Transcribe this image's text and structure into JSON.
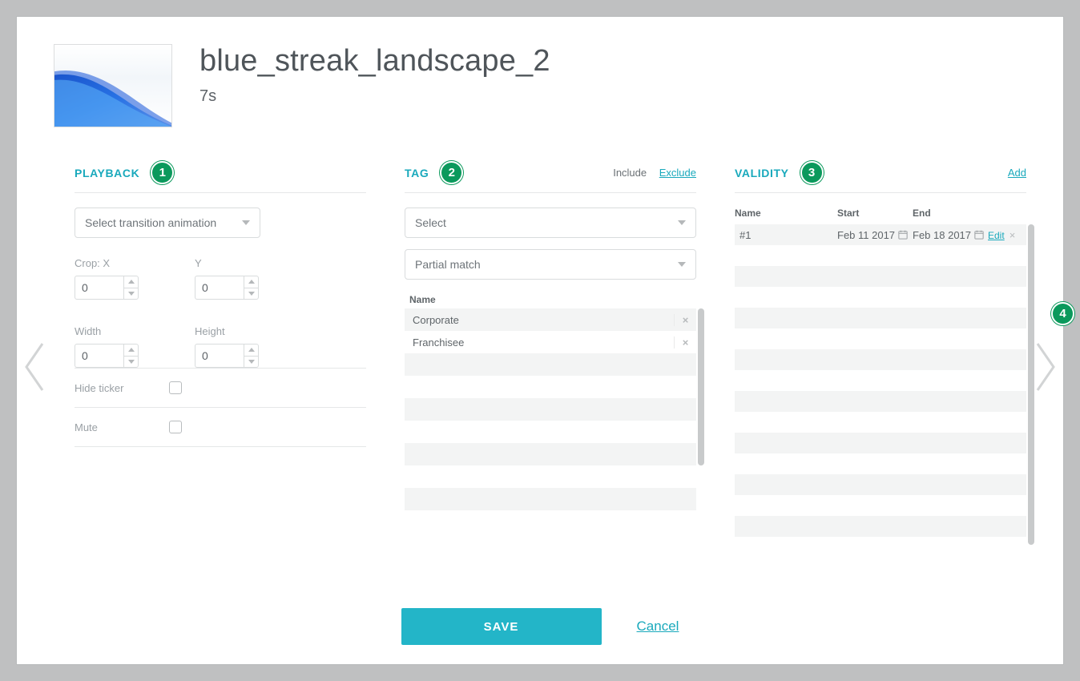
{
  "header": {
    "title": "blue_streak_landscape_2",
    "duration": "7s"
  },
  "playback": {
    "title": "PLAYBACK",
    "transition_placeholder": "Select transition animation",
    "crop_x_label": "Crop: X",
    "crop_y_label": "Y",
    "width_label": "Width",
    "height_label": "Height",
    "crop_x": "0",
    "crop_y": "0",
    "width": "0",
    "height": "0",
    "hide_ticker_label": "Hide ticker",
    "mute_label": "Mute"
  },
  "tag": {
    "title": "TAG",
    "include_label": "Include",
    "exclude_label": "Exclude",
    "select_placeholder": "Select",
    "match_placeholder": "Partial match",
    "name_header": "Name",
    "items": [
      {
        "name": "Corporate"
      },
      {
        "name": "Franchisee"
      }
    ]
  },
  "validity": {
    "title": "VALIDITY",
    "add_label": "Add",
    "col_name": "Name",
    "col_start": "Start",
    "col_end": "End",
    "edit_label": "Edit",
    "rows": [
      {
        "name": "#1",
        "start": "Feb 11 2017",
        "end": "Feb 18 2017"
      }
    ]
  },
  "footer": {
    "save": "SAVE",
    "cancel": "Cancel"
  },
  "badges": {
    "b1": "1",
    "b2": "2",
    "b3": "3",
    "b4": "4"
  },
  "extra_blank_rows": 10
}
